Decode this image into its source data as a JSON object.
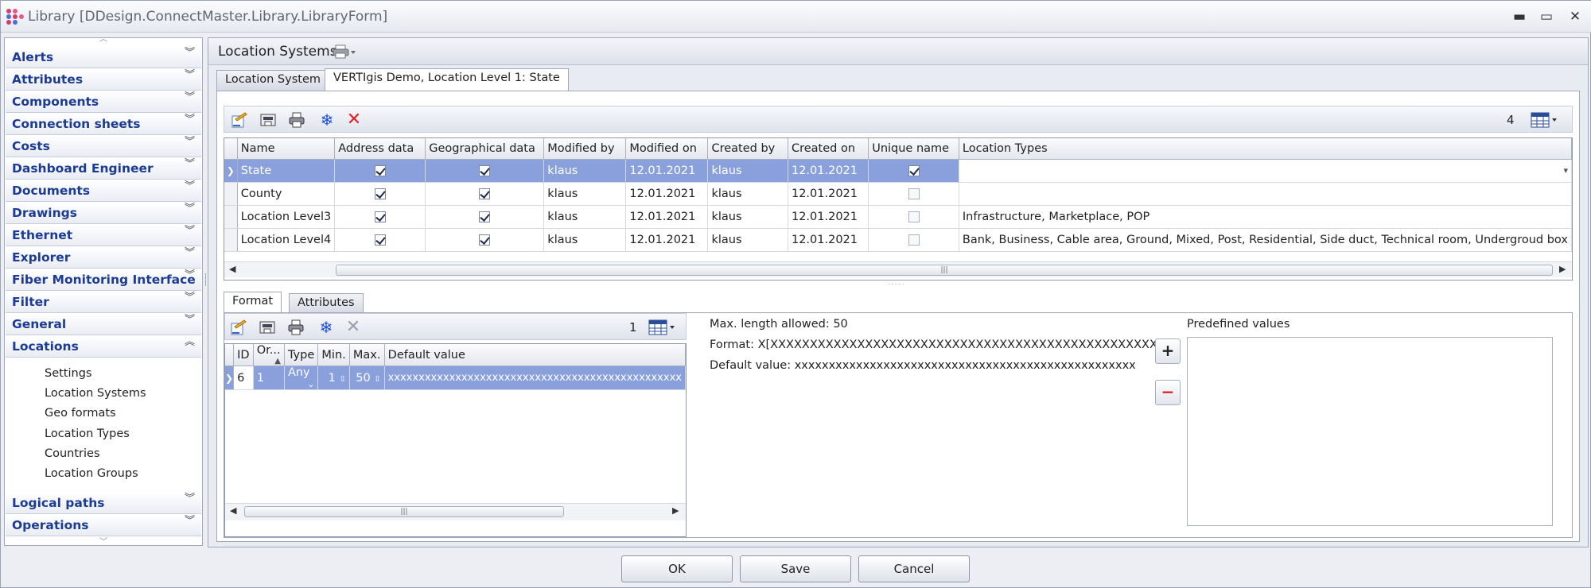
{
  "window": {
    "title": "Library [DDesign.ConnectMaster.Library.LibraryForm]",
    "controls": {
      "minimize": "▬",
      "restore": "▭",
      "close": "✕"
    }
  },
  "sidebar": {
    "groups": [
      {
        "label": "Alerts"
      },
      {
        "label": "Attributes"
      },
      {
        "label": "Components"
      },
      {
        "label": "Connection sheets"
      },
      {
        "label": "Costs"
      },
      {
        "label": "Dashboard Engineer"
      },
      {
        "label": "Documents"
      },
      {
        "label": "Drawings"
      },
      {
        "label": "Ethernet"
      },
      {
        "label": "Explorer"
      },
      {
        "label": "Fiber Monitoring Interface"
      },
      {
        "label": "Filter"
      },
      {
        "label": "General"
      },
      {
        "label": "Locations",
        "expanded": true
      },
      {
        "label": "Logical paths"
      },
      {
        "label": "Operations"
      }
    ],
    "locations_items": [
      "Settings",
      "Location Systems",
      "Geo formats",
      "Location Types",
      "Countries",
      "Location Groups"
    ]
  },
  "main": {
    "title": "Location Systems",
    "tabs": [
      "Location System",
      "VERTIgis Demo, Location Level 1: State"
    ],
    "toolbar": {
      "count": "4"
    },
    "grid": {
      "columns": [
        "Name",
        "Address data",
        "Geographical data",
        "Modified by",
        "Modified on",
        "Created by",
        "Created on",
        "Unique name",
        "Location Types"
      ],
      "rows": [
        {
          "name": "State",
          "address": true,
          "geo": true,
          "modified_by": "klaus",
          "modified_on": "12.01.2021",
          "created_by": "klaus",
          "created_on": "12.01.2021",
          "unique": true,
          "location_types": ""
        },
        {
          "name": "County",
          "address": true,
          "geo": true,
          "modified_by": "klaus",
          "modified_on": "12.01.2021",
          "created_by": "klaus",
          "created_on": "12.01.2021",
          "unique": false,
          "location_types": ""
        },
        {
          "name": "Location Level3",
          "address": true,
          "geo": true,
          "modified_by": "klaus",
          "modified_on": "12.01.2021",
          "created_by": "klaus",
          "created_on": "12.01.2021",
          "unique": false,
          "location_types": "Infrastructure, Marketplace, POP"
        },
        {
          "name": "Location Level4",
          "address": true,
          "geo": true,
          "modified_by": "klaus",
          "modified_on": "12.01.2021",
          "created_by": "klaus",
          "created_on": "12.01.2021",
          "unique": false,
          "location_types": "Bank, Business, Cable area, Ground, Mixed, Post, Residential, Side duct, Technical room, Undergroud box"
        }
      ]
    },
    "bottom_tabs": [
      "Format",
      "Attributes"
    ],
    "format": {
      "toolbar_count": "1",
      "columns": [
        "ID",
        "Or...",
        "Type",
        "Min.",
        "Max.",
        "Default value"
      ],
      "rows": [
        {
          "id": "6",
          "order": "1",
          "type": "Any",
          "min": "1",
          "max": "50",
          "default": "xxxxxxxxxxxxxxxxxxxxxxxxxxxxxxxxxxxxxxxxxxxxxxxx"
        }
      ],
      "max_length": "Max. length allowed: 50",
      "format_text": "Format: X[XXXXXXXXXXXXXXXXXXXXXXXXXXXXXXXXXXXXXXXXXXXXXXXXX]",
      "default_value_text": "Default value: xxxxxxxxxxxxxxxxxxxxxxxxxxxxxxxxxxxxxxxxxxxxxxxxxx",
      "predefined_label": "Predefined values",
      "add_symbol": "+",
      "remove_symbol": "−"
    }
  },
  "buttons": {
    "ok": "OK",
    "save": "Save",
    "cancel": "Cancel"
  },
  "colors": {
    "selection": "#8aa0dc",
    "group_label": "#1c3c94",
    "delete_icon": "#e02020"
  }
}
